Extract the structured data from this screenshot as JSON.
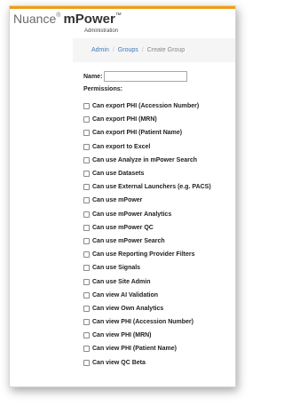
{
  "brand": {
    "name_part1": "Nuance",
    "registered_mark": "®",
    "name_part2": "mPower",
    "trademark": "™",
    "subtitle": "Administration",
    "accent_color": "#f39c12"
  },
  "breadcrumb": {
    "items": [
      "Admin",
      "Groups"
    ],
    "current": "Create Group",
    "separator": "/"
  },
  "form": {
    "name_label": "Name:",
    "name_value": "",
    "permissions_label": "Permissions:",
    "permissions": [
      "Can export PHI (Accession Number)",
      "Can export PHI (MRN)",
      "Can export PHI (Patient Name)",
      "Can export to Excel",
      "Can use Analyze in mPower Search",
      "Can use Datasets",
      "Can use External Launchers (e.g. PACS)",
      "Can use mPower",
      "Can use mPower Analytics",
      "Can use mPower QC",
      "Can use mPower Search",
      "Can use Reporting Provider Filters",
      "Can use Signals",
      "Can use Site Admin",
      "Can view AI Validation",
      "Can view Own Analytics",
      "Can view PHI (Accession Number)",
      "Can view PHI (MRN)",
      "Can view PHI (Patient Name)",
      "Can view QC Beta"
    ]
  }
}
